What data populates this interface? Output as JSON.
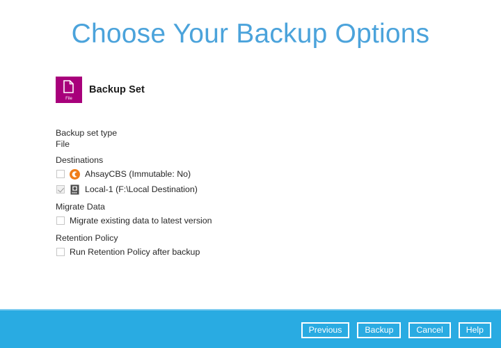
{
  "page": {
    "title": "Choose Your Backup Options",
    "title_color": "#4BA3DB",
    "background": "#ffffff"
  },
  "backup_set": {
    "icon_label": "File",
    "icon_color": "#A8007B",
    "title": "Backup Set"
  },
  "form": {
    "backup_set_type": {
      "label": "Backup set type",
      "value": "File"
    },
    "destinations": {
      "label": "Destinations",
      "items": [
        {
          "name": "AhsayCBS (Immutable: No)",
          "checked": false,
          "disabled": false,
          "icon": "ahsaycbs-cloud-icon",
          "icon_color": "#F07D18"
        },
        {
          "name": "Local-1 (F:\\Local Destination)",
          "checked": true,
          "disabled": true,
          "icon": "local-server-icon",
          "icon_color": "#4A4A4A"
        }
      ]
    },
    "migrate_data": {
      "label": "Migrate Data",
      "option": "Migrate existing data to latest version",
      "checked": false
    },
    "retention_policy": {
      "label": "Retention Policy",
      "option": "Run Retention Policy after backup",
      "checked": false
    }
  },
  "footer": {
    "background": "#29ABE2",
    "border_top": "#7ECBEF",
    "buttons": [
      {
        "label": "Previous"
      },
      {
        "label": "Backup"
      },
      {
        "label": "Cancel"
      },
      {
        "label": "Help"
      }
    ]
  }
}
